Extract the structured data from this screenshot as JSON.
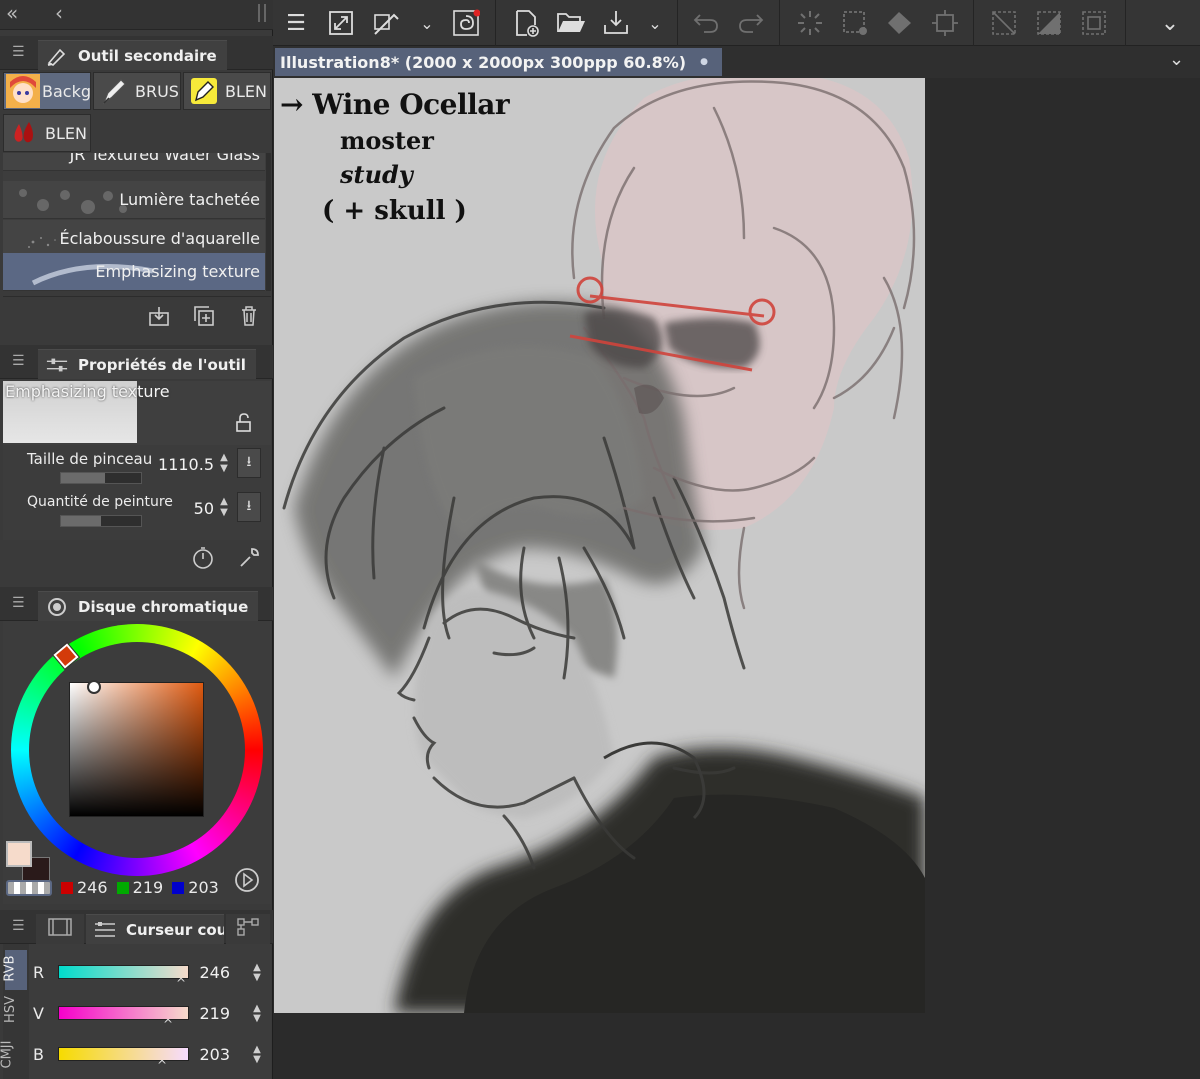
{
  "left_panel": {
    "collapse_icons": [
      "double-chevron-left-icon",
      "chevron-left-icon"
    ],
    "subtool_panel": {
      "title": "Outil secondaire",
      "groups": [
        {
          "label": "Backg",
          "selected": true
        },
        {
          "label": "BRUS",
          "selected": false
        },
        {
          "label": "BLEN",
          "selected": false
        },
        {
          "label": "BLEN",
          "selected": false
        }
      ],
      "brushes": [
        {
          "label": "JR Textured Water Glass",
          "selected": false
        },
        {
          "label": "Lumière tachetée",
          "selected": false
        },
        {
          "label": "Éclaboussure d'aquarelle",
          "selected": false
        },
        {
          "label": "Emphasizing texture",
          "selected": true
        }
      ]
    },
    "tool_properties": {
      "title": "Propriétés de l'outil",
      "tool_name": "Emphasizing texture",
      "brush_size_label": "Taille de pinceau",
      "brush_size_value": "1110.5",
      "brush_size_fraction": 0.55,
      "paint_amount_label": "Quantité de peinture",
      "paint_amount_value": "50",
      "paint_amount_fraction": 0.5
    },
    "color_wheel": {
      "title": "Disque chromatique",
      "main_color": "#f6dbcb",
      "sub_color": "#2a1a1a",
      "r": "246",
      "g": "219",
      "b": "203"
    },
    "color_slider": {
      "title": "Curseur cou",
      "mode_tabs": [
        "RVB",
        "HSV",
        "CMJI"
      ],
      "rows": [
        {
          "label": "R",
          "value": "246"
        },
        {
          "label": "V",
          "value": "219"
        },
        {
          "label": "B",
          "value": "203"
        }
      ]
    }
  },
  "document": {
    "tab_title": "Illustration8* (2000 x 2000px 300ppp 60.8%)",
    "modified_dot": "●"
  },
  "canvas_note": {
    "line1": "→ Wine Ocellar",
    "line2": "moster",
    "line3": "study",
    "line4": "( + skull )"
  }
}
